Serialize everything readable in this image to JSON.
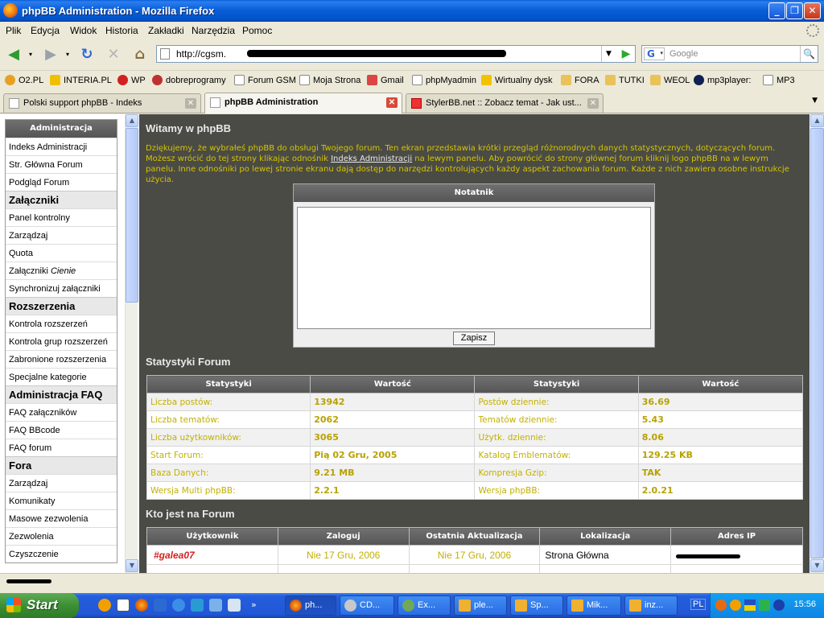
{
  "window": {
    "title": "phpBB Administration - Mozilla Firefox"
  },
  "menu": [
    "Plik",
    "Edycja",
    "Widok",
    "Historia",
    "Zakładki",
    "Narzędzia",
    "Pomoc"
  ],
  "address": {
    "url": "http://cgsm."
  },
  "search": {
    "placeholder": "Google",
    "engine": "G"
  },
  "bookmarks": [
    "O2.PL",
    "INTERIA.PL",
    "WP",
    "dobreprogramy",
    "Forum GSM",
    "Moja Strona",
    "Gmail",
    "phpMyadmin",
    "Wirtualny dysk",
    "FORA",
    "TUTKI",
    "WEOL",
    "mp3player:",
    "MP3"
  ],
  "tabs": [
    {
      "label": "Polski support phpBB - Indeks"
    },
    {
      "label": "phpBB Administration"
    },
    {
      "label": "StylerBB.net :: Zobacz temat - Jak ust..."
    }
  ],
  "sidebar": {
    "header": "Administracja",
    "general": [
      "Indeks Administracji",
      "Str. Główna Forum",
      "Podgląd Forum"
    ],
    "cat_attachments": "Załączniki",
    "attachments": [
      "Panel kontrolny",
      "Zarządzaj",
      "Quota"
    ],
    "attachments_shadow_prefix": "Załączniki",
    "attachments_shadow_suffix": "Cienie",
    "attachments_sync": "Synchronizuj załączniki",
    "cat_extensions": "Rozszerzenia",
    "extensions": [
      "Kontrola rozszerzeń",
      "Kontrola grup rozszerzeń",
      "Zabronione rozszerzenia",
      "Specjalne kategorie"
    ],
    "cat_faq": "Administracja FAQ",
    "faq": [
      "FAQ załączników",
      "FAQ BBcode",
      "FAQ forum"
    ],
    "cat_forums": "Fora",
    "forums": [
      "Zarządzaj",
      "Komunikaty",
      "Masowe zezwolenia",
      "Zezwolenia",
      "Czyszczenie"
    ]
  },
  "main": {
    "title": "Witamy w phpBB",
    "intro_1": "Dziękujemy, że wybrałeś phpBB do obsługi Twojego forum. Ten ekran przedstawia krótki przegląd różnorodnych danych statystycznych, dotyczących forum. Możesz wrócić do tej strony klikając odnośnik ",
    "intro_link": "Indeks Administracji",
    "intro_2": " na lewym panelu. Aby powrócić do strony głównej forum kliknij logo phpBB na w lewym panelu. Inne odnośniki po lewej stronie ekranu dają dostęp do narzędzi kontrolujących każdy aspekt zachowania forum. Każde z nich zawiera osobne instrukcje użycia.",
    "notepad_title": "Notatnik",
    "notepad_save": "Zapisz",
    "stats_title": "Statystyki Forum",
    "stats_headers": [
      "Statystyki",
      "Wartość",
      "Statystyki",
      "Wartość"
    ],
    "stats_rows": [
      [
        "Liczba postów:",
        "13942",
        "Postów dziennie:",
        "36.69"
      ],
      [
        "Liczba tematów:",
        "2062",
        "Tematów dziennie:",
        "5.43"
      ],
      [
        "Liczba użytkowników:",
        "3065",
        "Użytk. dziennie:",
        "8.06"
      ],
      [
        "Start Forum:",
        "Pią 02 Gru, 2005",
        "Katalog Emblematów:",
        "129.25 KB"
      ],
      [
        "Baza Danych:",
        "9.21 MB",
        "Kompresja Gzip:",
        "TAK"
      ],
      [
        "Wersja Multi phpBB:",
        "2.2.1",
        "Wersja phpBB:",
        "2.0.21"
      ]
    ],
    "online_title": "Kto jest na Forum",
    "online_headers": [
      "Użytkownik",
      "Zaloguj",
      "Ostatnia Aktualizacja",
      "Lokalizacja",
      "Adres IP"
    ],
    "online_rows": [
      [
        "#galea07",
        "Nie 17 Gru, 2006",
        "Nie 17 Gru, 2006",
        "Strona Główna"
      ]
    ]
  },
  "taskbar": {
    "start": "Start",
    "tasks": [
      "ph...",
      "CD...",
      "Ex...",
      "ple...",
      "Sp...",
      "Mik...",
      "inz..."
    ],
    "lang": "PL",
    "clock": "15:56"
  }
}
